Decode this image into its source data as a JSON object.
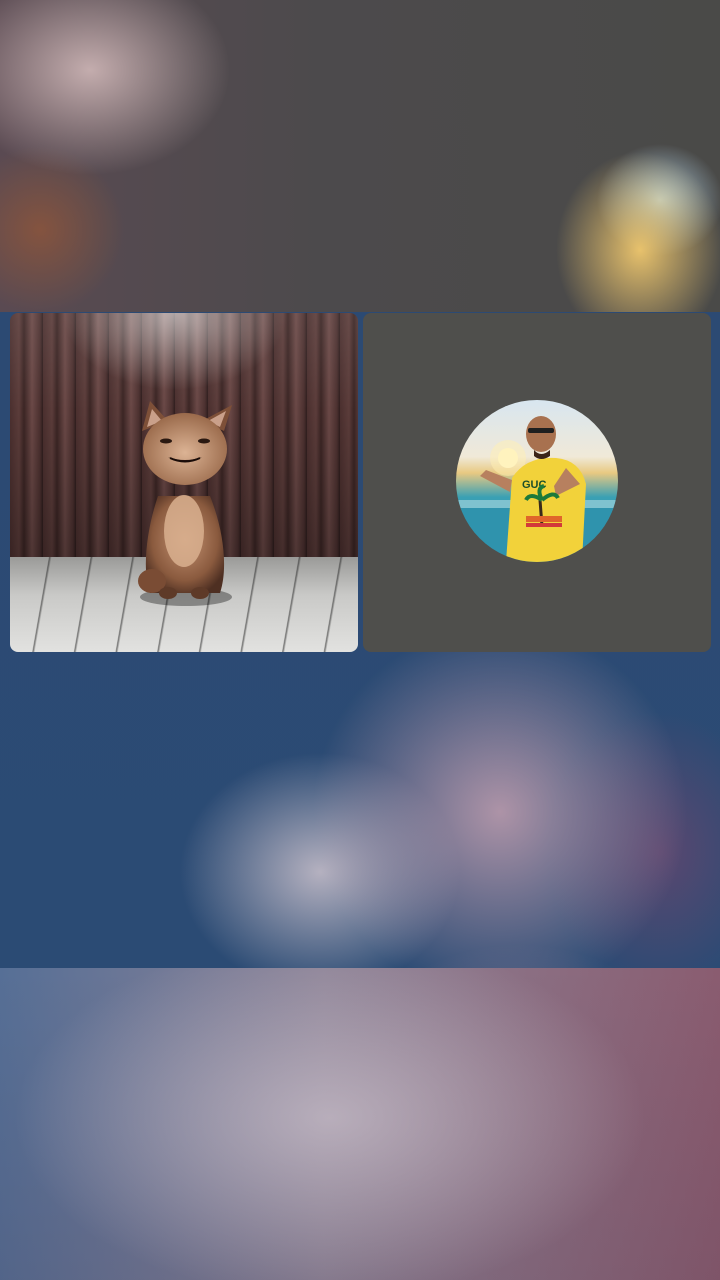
{
  "call": {
    "participants": [
      {
        "name": "",
        "video": "animated-cat-avatar",
        "role": "self-preview"
      },
      {
        "name": "",
        "video": "off",
        "avatar": "profile-photo"
      }
    ]
  },
  "colors": {
    "background_blue": "#2c4a73",
    "tile_gray": "#4f4f4c",
    "shirt_yellow": "#f2d23a"
  },
  "icons": [
    "cat-avatar-icon",
    "profile-avatar"
  ]
}
